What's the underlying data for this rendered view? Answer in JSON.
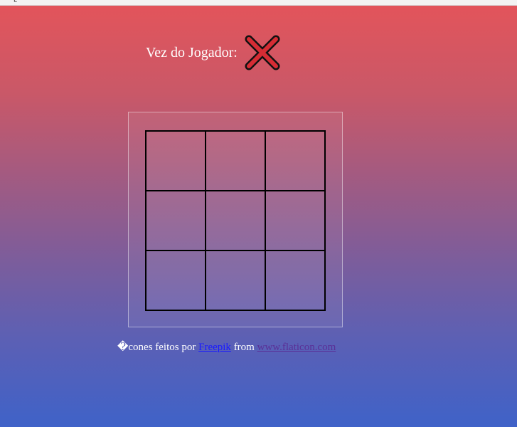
{
  "window": {
    "top_glyph": "¿"
  },
  "turn": {
    "label": "Vez do Jogador:",
    "current_player": "X",
    "icon": "x-icon",
    "icon_color": "#d62c34"
  },
  "board": {
    "cells": [
      "",
      "",
      "",
      "",
      "",
      "",
      "",
      "",
      ""
    ]
  },
  "credits": {
    "prefix": "�cones feitos por",
    "author_link": "Freepik",
    "middle": "from",
    "site_link": "www.flaticon.com"
  },
  "colors": {
    "bg_top": "#e4545a",
    "bg_bottom": "#3f62c8",
    "grid_line": "#000000",
    "author_link": "#1a1aff",
    "site_link": "#5a2f97"
  }
}
